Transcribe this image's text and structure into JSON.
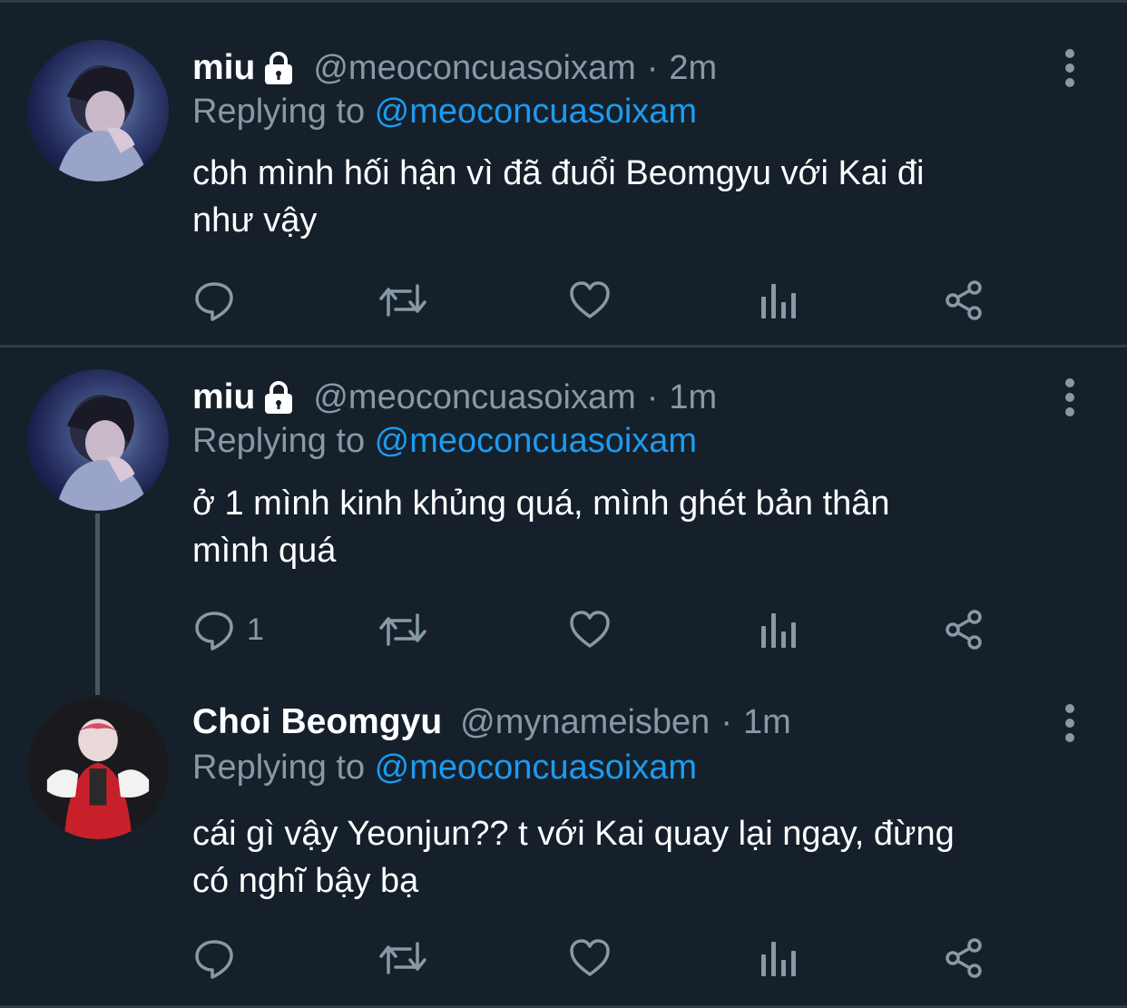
{
  "tweets": [
    {
      "name": "miu",
      "protected": true,
      "handle": "@meoconcuasoixam",
      "separator": "·",
      "time": "2m",
      "replying_prefix": "Replying to ",
      "replying_to": "@meoconcuasoixam",
      "text": "cbh mình hối hận vì đã đuổi Beomgyu với Kai đi\nnhư vậy",
      "reply_count": "",
      "avatar_icon": "avatar-miu"
    },
    {
      "name": "miu",
      "protected": true,
      "handle": "@meoconcuasoixam",
      "separator": "·",
      "time": "1m",
      "replying_prefix": "Replying to ",
      "replying_to": "@meoconcuasoixam",
      "text": "ở 1 mình kinh khủng quá, mình ghét bản thân\nmình quá",
      "reply_count": "1",
      "avatar_icon": "avatar-miu"
    },
    {
      "name": "Choi Beomgyu",
      "protected": false,
      "handle": "@mynameisben",
      "separator": "·",
      "time": "1m",
      "replying_prefix": "Replying to ",
      "replying_to": "@meoconcuasoixam",
      "text": "cái gì vậy Yeonjun?? t với Kai quay lại ngay, đừng\ncó nghĩ bậy bạ",
      "reply_count": "",
      "avatar_icon": "avatar-beomgyu"
    }
  ],
  "icons": {
    "protected": "lock-icon",
    "more": "more-vertical-icon",
    "reply": "reply-icon",
    "retweet": "retweet-icon",
    "like": "heart-icon",
    "analytics": "analytics-icon",
    "share": "share-icon"
  },
  "colors": {
    "background": "#15202b",
    "text_primary": "#ffffff",
    "text_secondary": "#8899a6",
    "link": "#1d9bf0",
    "divider": "#2f3b47"
  }
}
